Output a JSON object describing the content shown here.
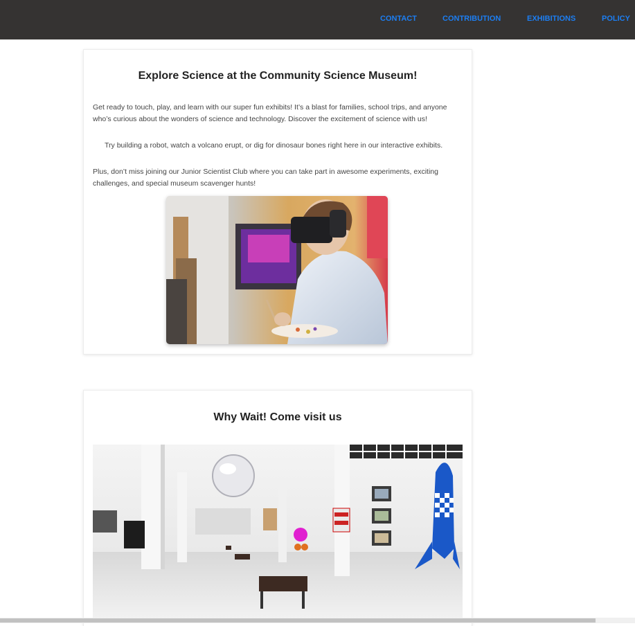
{
  "nav": {
    "items": [
      "CONTACT",
      "CONTRIBUTION",
      "EXHIBITIONS",
      "POLICY"
    ],
    "link_color": "#1c7ef2",
    "bar_color": "#353332"
  },
  "section1": {
    "title": "Explore Science at the Community Science Museum!",
    "paragraphs": [
      "Get ready to touch, play, and learn with our super fun exhibits! It’s a blast for families, school trips, and anyone who’s curious about the wonders of science and technology. Discover the excitement of science with us!",
      "Try building a robot, watch a volcano erupt, or dig for dinosaur bones right here in our interactive exhibits.",
      "Plus, don’t miss joining our Junior Scientist Club where you can take part in awesome experiments, exciting challenges, and special museum scavenger hunts!"
    ],
    "image": "vr-headset-student-photo"
  },
  "section2": {
    "title": "Why Wait! Come visit us",
    "image": "museum-gallery-interior-photo"
  }
}
